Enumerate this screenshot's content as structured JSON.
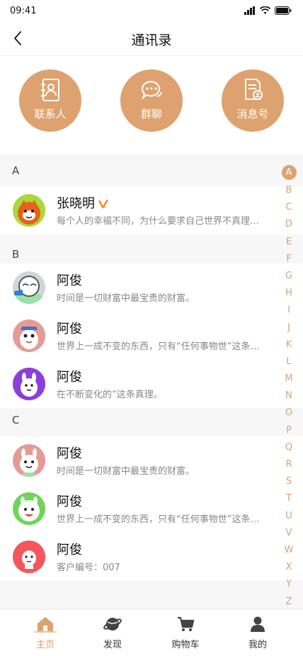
{
  "status": {
    "time": "09:41"
  },
  "nav": {
    "title": "通讯录"
  },
  "quick": [
    {
      "label": "联系人",
      "icon": "contacts-book-icon"
    },
    {
      "label": "群聊",
      "icon": "chat-bubbles-icon"
    },
    {
      "label": "消息号",
      "icon": "message-account-icon"
    }
  ],
  "sections": [
    {
      "letter": "A",
      "contacts": [
        {
          "name": "张晓明",
          "sub": "每个人的幸福不同，为什么要求自己世界不真理…",
          "verified": true
        }
      ]
    },
    {
      "letter": "B",
      "contacts": [
        {
          "name": "阿俊",
          "sub": "时间是一切财富中最宝贵的财富。"
        },
        {
          "name": "阿俊",
          "sub": "世界上一成不变的东西，只有“任何事物世”这条…"
        },
        {
          "name": "阿俊",
          "sub": "在不断变化的”这条真理。"
        }
      ]
    },
    {
      "letter": "C",
      "contacts": [
        {
          "name": "阿俊",
          "sub": "时间是一切财富中最宝贵的财富。"
        },
        {
          "name": "阿俊",
          "sub": "世界上一成不变的东西，只有“任何事物世”这条…"
        },
        {
          "name": "阿俊",
          "sub": "客户编号：007"
        }
      ]
    }
  ],
  "index": [
    "A",
    "B",
    "C",
    "D",
    "E",
    "F",
    "G",
    "H",
    "I",
    "J",
    "K",
    "L",
    "M",
    "N",
    "O",
    "P",
    "Q",
    "R",
    "S",
    "T",
    "U",
    "V",
    "W",
    "X",
    "Y",
    "Z"
  ],
  "index_active": "A",
  "tabs": [
    {
      "label": "主页",
      "icon": "home-icon",
      "active": true
    },
    {
      "label": "发现",
      "icon": "planet-icon",
      "active": false
    },
    {
      "label": "购物车",
      "icon": "cart-icon",
      "active": false
    },
    {
      "label": "我的",
      "icon": "user-icon",
      "active": false
    }
  ],
  "colors": {
    "accent": "#dda26f",
    "accent_text": "#d9a273",
    "bg": "#f7f7f7"
  }
}
